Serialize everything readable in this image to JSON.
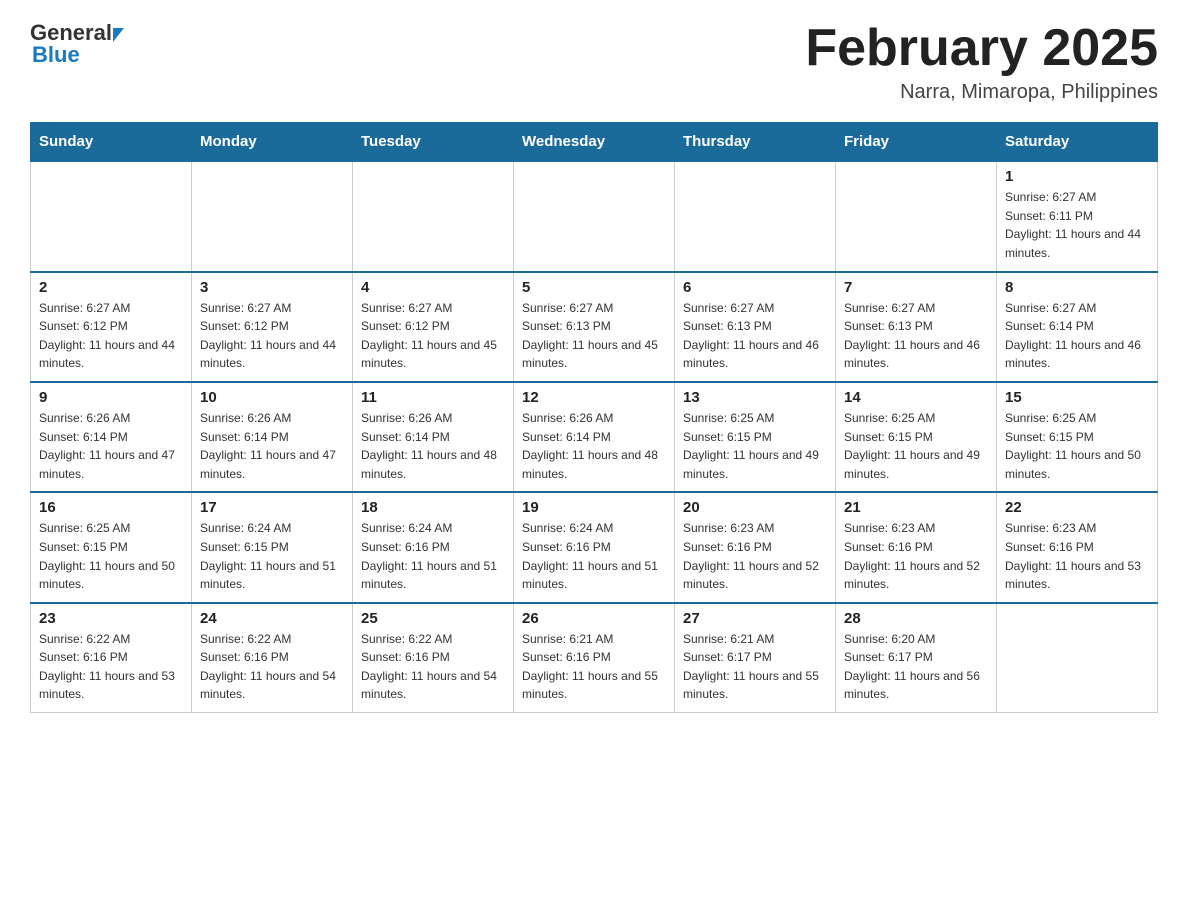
{
  "header": {
    "logo_general": "General",
    "logo_blue": "Blue",
    "month_title": "February 2025",
    "location": "Narra, Mimaropa, Philippines"
  },
  "calendar": {
    "days_of_week": [
      "Sunday",
      "Monday",
      "Tuesday",
      "Wednesday",
      "Thursday",
      "Friday",
      "Saturday"
    ],
    "weeks": [
      [
        {
          "day": "",
          "info": ""
        },
        {
          "day": "",
          "info": ""
        },
        {
          "day": "",
          "info": ""
        },
        {
          "day": "",
          "info": ""
        },
        {
          "day": "",
          "info": ""
        },
        {
          "day": "",
          "info": ""
        },
        {
          "day": "1",
          "info": "Sunrise: 6:27 AM\nSunset: 6:11 PM\nDaylight: 11 hours and 44 minutes."
        }
      ],
      [
        {
          "day": "2",
          "info": "Sunrise: 6:27 AM\nSunset: 6:12 PM\nDaylight: 11 hours and 44 minutes."
        },
        {
          "day": "3",
          "info": "Sunrise: 6:27 AM\nSunset: 6:12 PM\nDaylight: 11 hours and 44 minutes."
        },
        {
          "day": "4",
          "info": "Sunrise: 6:27 AM\nSunset: 6:12 PM\nDaylight: 11 hours and 45 minutes."
        },
        {
          "day": "5",
          "info": "Sunrise: 6:27 AM\nSunset: 6:13 PM\nDaylight: 11 hours and 45 minutes."
        },
        {
          "day": "6",
          "info": "Sunrise: 6:27 AM\nSunset: 6:13 PM\nDaylight: 11 hours and 46 minutes."
        },
        {
          "day": "7",
          "info": "Sunrise: 6:27 AM\nSunset: 6:13 PM\nDaylight: 11 hours and 46 minutes."
        },
        {
          "day": "8",
          "info": "Sunrise: 6:27 AM\nSunset: 6:14 PM\nDaylight: 11 hours and 46 minutes."
        }
      ],
      [
        {
          "day": "9",
          "info": "Sunrise: 6:26 AM\nSunset: 6:14 PM\nDaylight: 11 hours and 47 minutes."
        },
        {
          "day": "10",
          "info": "Sunrise: 6:26 AM\nSunset: 6:14 PM\nDaylight: 11 hours and 47 minutes."
        },
        {
          "day": "11",
          "info": "Sunrise: 6:26 AM\nSunset: 6:14 PM\nDaylight: 11 hours and 48 minutes."
        },
        {
          "day": "12",
          "info": "Sunrise: 6:26 AM\nSunset: 6:14 PM\nDaylight: 11 hours and 48 minutes."
        },
        {
          "day": "13",
          "info": "Sunrise: 6:25 AM\nSunset: 6:15 PM\nDaylight: 11 hours and 49 minutes."
        },
        {
          "day": "14",
          "info": "Sunrise: 6:25 AM\nSunset: 6:15 PM\nDaylight: 11 hours and 49 minutes."
        },
        {
          "day": "15",
          "info": "Sunrise: 6:25 AM\nSunset: 6:15 PM\nDaylight: 11 hours and 50 minutes."
        }
      ],
      [
        {
          "day": "16",
          "info": "Sunrise: 6:25 AM\nSunset: 6:15 PM\nDaylight: 11 hours and 50 minutes."
        },
        {
          "day": "17",
          "info": "Sunrise: 6:24 AM\nSunset: 6:15 PM\nDaylight: 11 hours and 51 minutes."
        },
        {
          "day": "18",
          "info": "Sunrise: 6:24 AM\nSunset: 6:16 PM\nDaylight: 11 hours and 51 minutes."
        },
        {
          "day": "19",
          "info": "Sunrise: 6:24 AM\nSunset: 6:16 PM\nDaylight: 11 hours and 51 minutes."
        },
        {
          "day": "20",
          "info": "Sunrise: 6:23 AM\nSunset: 6:16 PM\nDaylight: 11 hours and 52 minutes."
        },
        {
          "day": "21",
          "info": "Sunrise: 6:23 AM\nSunset: 6:16 PM\nDaylight: 11 hours and 52 minutes."
        },
        {
          "day": "22",
          "info": "Sunrise: 6:23 AM\nSunset: 6:16 PM\nDaylight: 11 hours and 53 minutes."
        }
      ],
      [
        {
          "day": "23",
          "info": "Sunrise: 6:22 AM\nSunset: 6:16 PM\nDaylight: 11 hours and 53 minutes."
        },
        {
          "day": "24",
          "info": "Sunrise: 6:22 AM\nSunset: 6:16 PM\nDaylight: 11 hours and 54 minutes."
        },
        {
          "day": "25",
          "info": "Sunrise: 6:22 AM\nSunset: 6:16 PM\nDaylight: 11 hours and 54 minutes."
        },
        {
          "day": "26",
          "info": "Sunrise: 6:21 AM\nSunset: 6:16 PM\nDaylight: 11 hours and 55 minutes."
        },
        {
          "day": "27",
          "info": "Sunrise: 6:21 AM\nSunset: 6:17 PM\nDaylight: 11 hours and 55 minutes."
        },
        {
          "day": "28",
          "info": "Sunrise: 6:20 AM\nSunset: 6:17 PM\nDaylight: 11 hours and 56 minutes."
        },
        {
          "day": "",
          "info": ""
        }
      ]
    ]
  }
}
